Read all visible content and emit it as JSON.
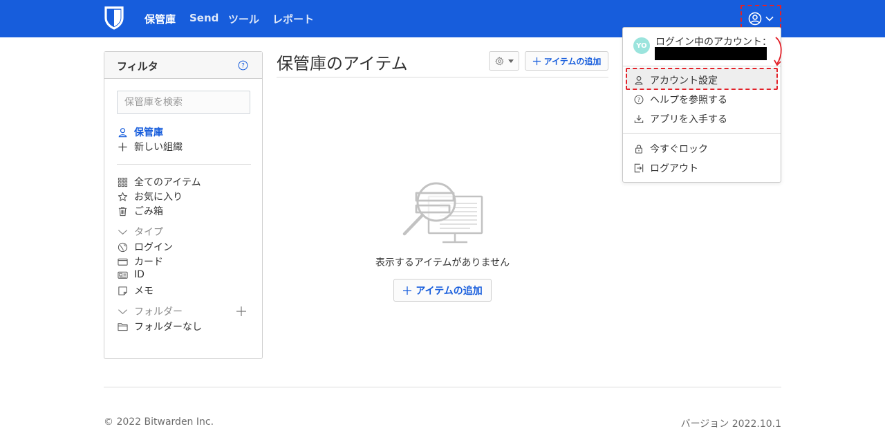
{
  "nav": {
    "links": [
      {
        "label": "保管庫",
        "active": true
      },
      {
        "label": "Send",
        "active": false
      },
      {
        "label": "ツール",
        "active": false
      },
      {
        "label": "レポート",
        "active": false
      }
    ]
  },
  "sidebar": {
    "title": "フィルタ",
    "search_placeholder": "保管庫を検索",
    "vault_label": "保管庫",
    "new_org_label": "新しい組織",
    "all_items": "全てのアイテム",
    "favorites": "お気に入り",
    "trash": "ごみ箱",
    "types_header": "タイプ",
    "types": [
      "ログイン",
      "カード",
      "ID",
      "メモ"
    ],
    "folders_header": "フォルダー",
    "no_folder": "フォルダーなし"
  },
  "main": {
    "title": "保管庫のアイテム",
    "add_item_label": "アイテムの追加",
    "empty_text": "表示するアイテムがありません",
    "add_item_center_label": "アイテムの追加"
  },
  "dropdown": {
    "avatar_initials": "YO",
    "logged_in_label": "ログイン中のアカウント：",
    "items": [
      {
        "label": "アカウント設定",
        "icon": "person-icon"
      },
      {
        "label": "ヘルプを参照する",
        "icon": "question-circle-icon"
      },
      {
        "label": "アプリを入手する",
        "icon": "download-icon"
      },
      {
        "label": "今すぐロック",
        "icon": "lock-icon"
      },
      {
        "label": "ログアウト",
        "icon": "sign-out-icon"
      }
    ]
  },
  "footer": {
    "copyright": "© 2022 Bitwarden Inc.",
    "version": "バージョン 2022.10.1"
  },
  "colors": {
    "brand": "#175ddc",
    "highlight_dash": "#e32129",
    "avatar": "#9be4dd"
  }
}
